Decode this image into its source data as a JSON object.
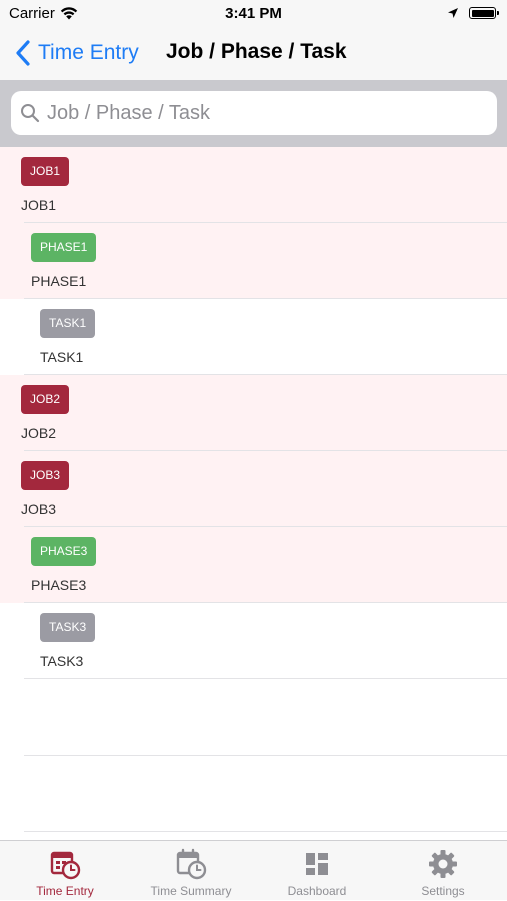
{
  "status_bar": {
    "carrier": "Carrier",
    "time": "3:41 PM"
  },
  "nav": {
    "back_label": "Time Entry",
    "title": "Job / Phase / Task"
  },
  "search": {
    "placeholder": "Job / Phase / Task",
    "value": ""
  },
  "colors": {
    "accent_blue": "#1e7cf5",
    "job_badge": "#a3283d",
    "phase_badge": "#5cb464",
    "task_badge": "#9b9ba3",
    "row_tint": "#fff2f3",
    "active_tab": "#a3283d"
  },
  "rows": [
    {
      "type": "job",
      "badge": "JOB1",
      "label": "JOB1"
    },
    {
      "type": "phase",
      "badge": "PHASE1",
      "label": "PHASE1"
    },
    {
      "type": "task",
      "badge": "TASK1",
      "label": "TASK1"
    },
    {
      "type": "job",
      "badge": "JOB2",
      "label": "JOB2"
    },
    {
      "type": "job",
      "badge": "JOB3",
      "label": "JOB3"
    },
    {
      "type": "phase",
      "badge": "PHASE3",
      "label": "PHASE3"
    },
    {
      "type": "task",
      "badge": "TASK3",
      "label": "TASK3"
    }
  ],
  "tabs": [
    {
      "label": "Time Entry",
      "icon": "calendar-clock-icon",
      "active": true
    },
    {
      "label": "Time Summary",
      "icon": "calendar-clock-icon",
      "active": false
    },
    {
      "label": "Dashboard",
      "icon": "dashboard-grid-icon",
      "active": false
    },
    {
      "label": "Settings",
      "icon": "gear-icon",
      "active": false
    }
  ]
}
